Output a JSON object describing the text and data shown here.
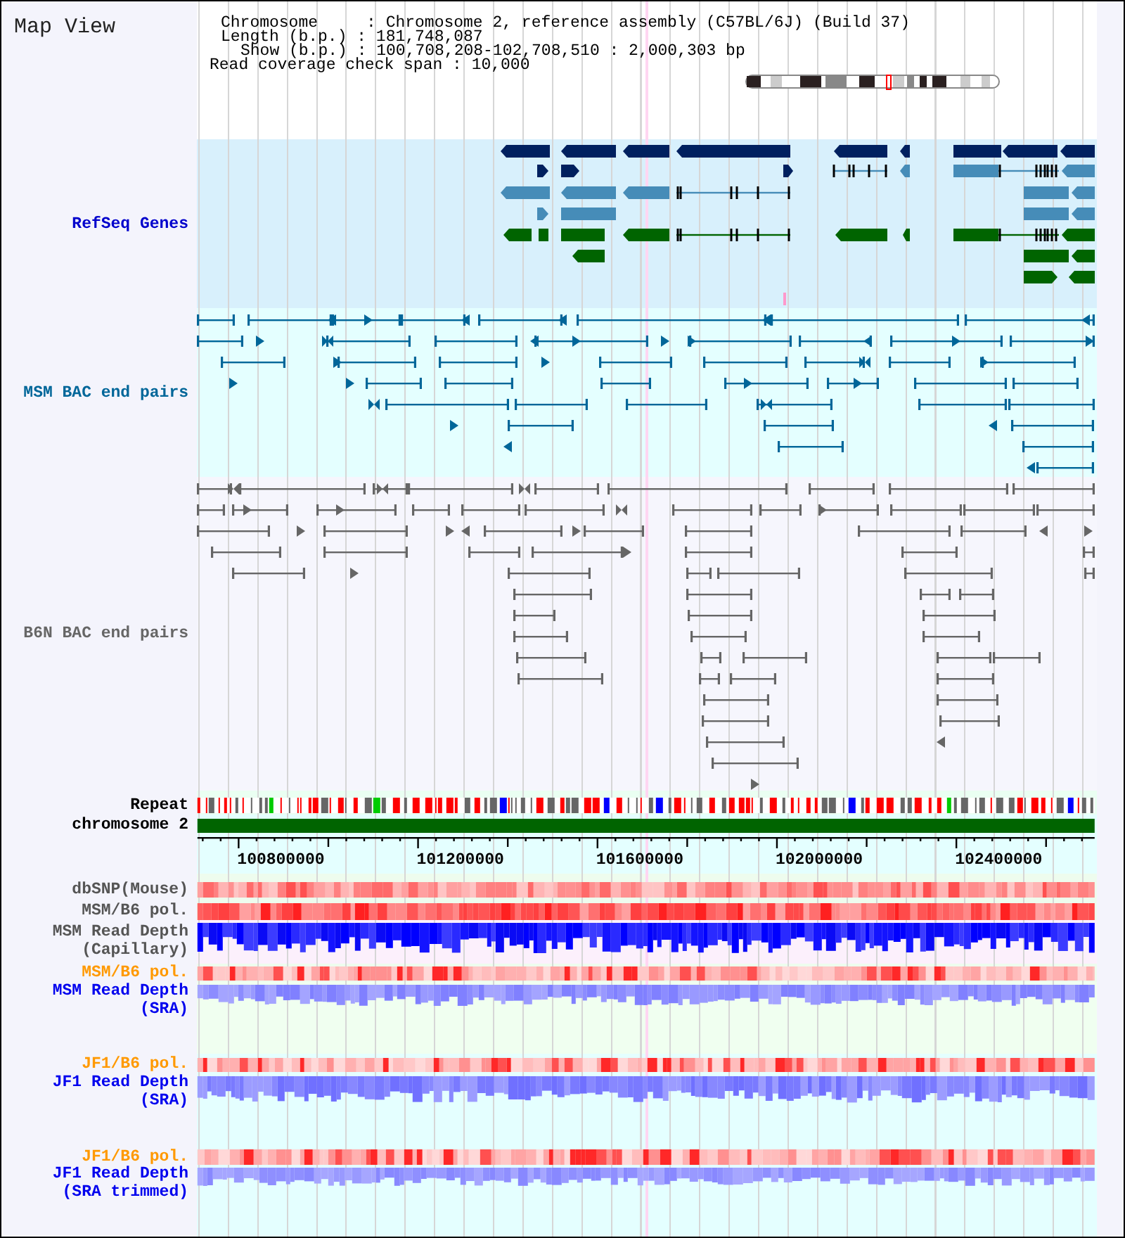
{
  "title": "Map View",
  "info_lines": [
    "Chromosome     : Chromosome 2, reference assembly (C57BL/6J) (Build 37)",
    "Length (b.p.) : 181,748,087",
    "Show (b.p.) : 100,708,208-102,708,510 : 2,000,303 bp",
    "Read coverage check span : 10,000"
  ],
  "tracks": [
    {
      "kind": "genes",
      "label": "RefSeq Genes",
      "color": "#0000cc"
    },
    {
      "kind": "pairs",
      "label": "MSM BAC end pairs",
      "color": "#006699"
    },
    {
      "kind": "pairs",
      "label": "B6N BAC end pairs",
      "color": "#666666"
    },
    {
      "kind": "repeat",
      "label": "Repeat",
      "color": "#000000"
    },
    {
      "kind": "chromosome",
      "label": "chromosome 2",
      "color": "#000000"
    },
    {
      "kind": "axis",
      "tick_labels": [
        "100800000",
        "101200000",
        "101600000",
        "102000000",
        "102400000"
      ]
    },
    {
      "kind": "heat",
      "label": "dbSNP(Mouse)",
      "color": "#555555"
    },
    {
      "kind": "heat",
      "label": "MSM/B6 pol.",
      "color": "#555555"
    },
    {
      "kind": "depth",
      "label": "MSM Read Depth (Capillary)",
      "color": "#555555"
    },
    {
      "kind": "heat",
      "label": "MSM/B6 pol.",
      "color": "#ff9900"
    },
    {
      "kind": "depth",
      "label": "MSM Read Depth (SRA)",
      "color": "#0000ee"
    },
    {
      "kind": "heat",
      "label": "JF1/B6 pol.",
      "color": "#ff9900"
    },
    {
      "kind": "depth",
      "label": "JF1 Read Depth (SRA)",
      "color": "#0000ee"
    },
    {
      "kind": "heat",
      "label": "JF1/B6 pol.",
      "color": "#ff9900"
    },
    {
      "kind": "depth",
      "label": "JF1 Read Depth (SRA trimmed)",
      "color": "#0000ee"
    }
  ]
}
